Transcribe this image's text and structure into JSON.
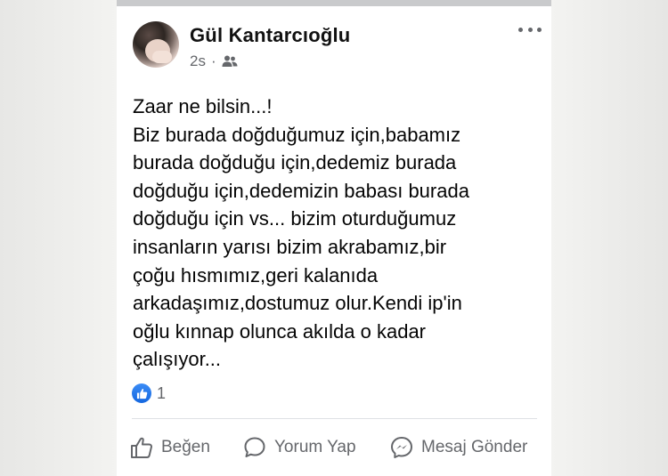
{
  "post": {
    "author": "Gül Kantarcıoğlu",
    "time": "2s",
    "separator": "·",
    "privacy_icon": "friends-icon",
    "more_icon": "more-options-icon",
    "text": "Zaar ne bilsin...!\nBiz burada doğduğumuz için,babamız\nburada doğduğu için,dedemiz burada\ndoğduğu için,dedemizin babası burada\ndoğduğu için vs... bizim oturduğumuz\ninsanların yarısı bizim akrabamız,bir\nçoğu hısmımız,geri kalanıda\narkadaşımız,dostumuz olur.Kendi ip'in\noğlu kınnap olunca akılda o kadar\nçalışıyor...",
    "reactions": {
      "icon": "like-reaction-icon",
      "count": "1"
    }
  },
  "actions": {
    "like_label": "Beğen",
    "comment_label": "Yorum Yap",
    "message_label": "Mesaj Gönder"
  },
  "colors": {
    "accent": "#1877f2",
    "secondary_text": "#65676b",
    "primary_text": "#050505"
  }
}
